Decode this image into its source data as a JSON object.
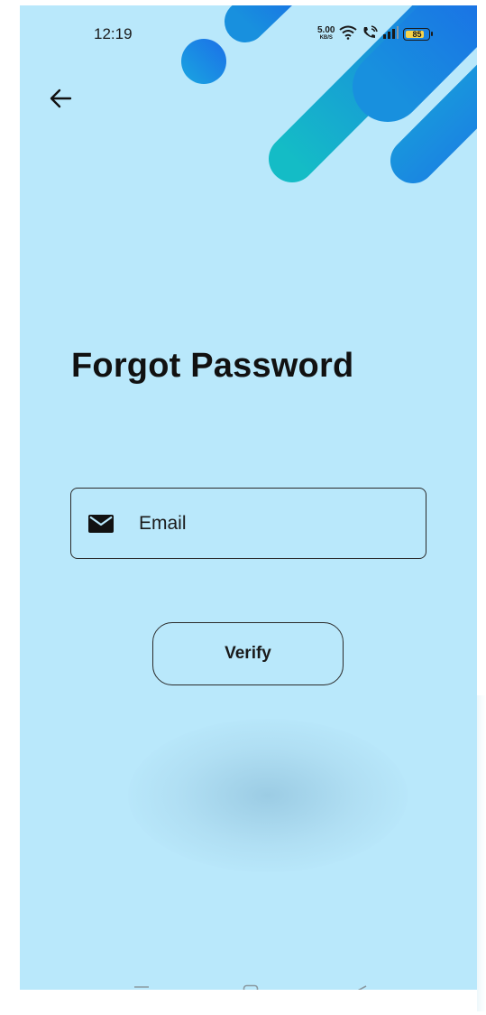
{
  "status_bar": {
    "time": "12:19",
    "net_speed_value": "5.00",
    "net_speed_unit": "KB/S",
    "battery_level": "85",
    "battery_fraction": 0.85
  },
  "header": {
    "back_icon": "arrow-left-icon"
  },
  "main": {
    "title": "Forgot Password",
    "email": {
      "icon": "mail-icon",
      "placeholder": "Email",
      "value": ""
    },
    "verify_label": "Verify"
  },
  "nav_bar": {
    "menu_icon": "menu-icon",
    "home_icon": "home-square-icon",
    "back_icon": "back-triangle-icon"
  },
  "colors": {
    "background": "#b9e8fb",
    "accent_blue": "#1e78e6",
    "accent_teal": "#14b4c8"
  }
}
